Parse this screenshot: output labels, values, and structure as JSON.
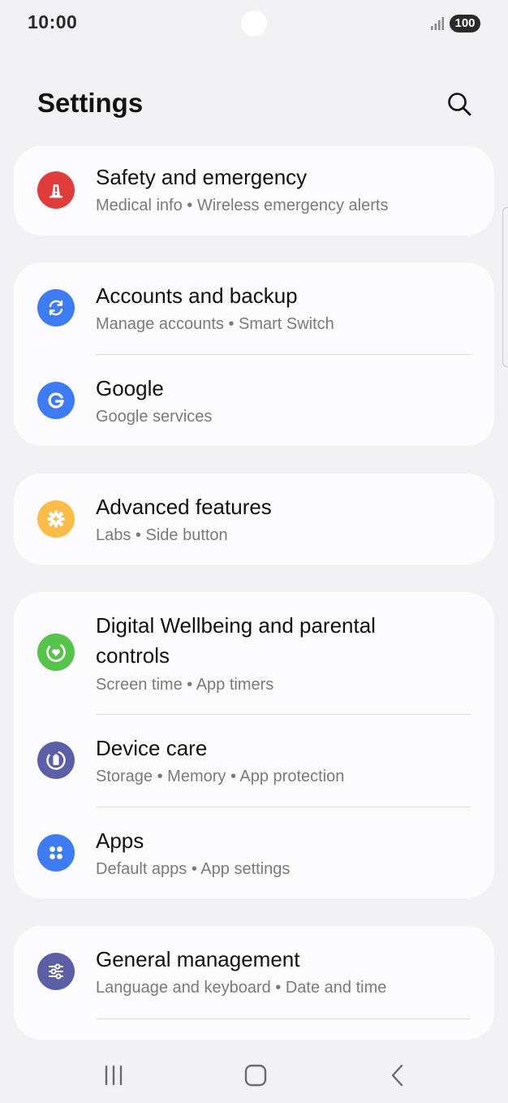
{
  "status_bar": {
    "time": "10:00",
    "battery": "100"
  },
  "header": {
    "title": "Settings"
  },
  "colors": {
    "safety": "#e03c3c",
    "accounts": "#3f7bf2",
    "google": "#3f7bf2",
    "advanced": "#fbbd49",
    "wellbeing": "#56c34a",
    "device_care": "#5d5fa6",
    "apps": "#3f7bf2",
    "general": "#5d5fa6"
  },
  "items": {
    "safety": {
      "title": "Safety and emergency",
      "subtitle": "Medical info  •  Wireless emergency alerts",
      "icon": "alert-icon"
    },
    "accounts": {
      "title": "Accounts and backup",
      "subtitle": "Manage accounts  •  Smart Switch",
      "icon": "sync-icon"
    },
    "google": {
      "title": "Google",
      "subtitle": "Google services",
      "icon": "google-icon"
    },
    "advanced": {
      "title": "Advanced features",
      "subtitle": "Labs  •  Side button",
      "icon": "gear-plus-icon"
    },
    "wellbeing": {
      "title": "Digital Wellbeing and parental controls",
      "subtitle": "Screen time  •  App timers",
      "icon": "heart-ring-icon"
    },
    "device_care": {
      "title": "Device care",
      "subtitle": "Storage  •  Memory  •  App protection",
      "icon": "battery-ring-icon"
    },
    "apps": {
      "title": "Apps",
      "subtitle": "Default apps  •  App settings",
      "icon": "dots-grid-icon"
    },
    "general": {
      "title": "General management",
      "subtitle": "Language and keyboard  •  Date and time",
      "icon": "sliders-icon"
    }
  },
  "nav": {
    "recents": "recents-icon",
    "home": "home-icon",
    "back": "back-icon"
  }
}
